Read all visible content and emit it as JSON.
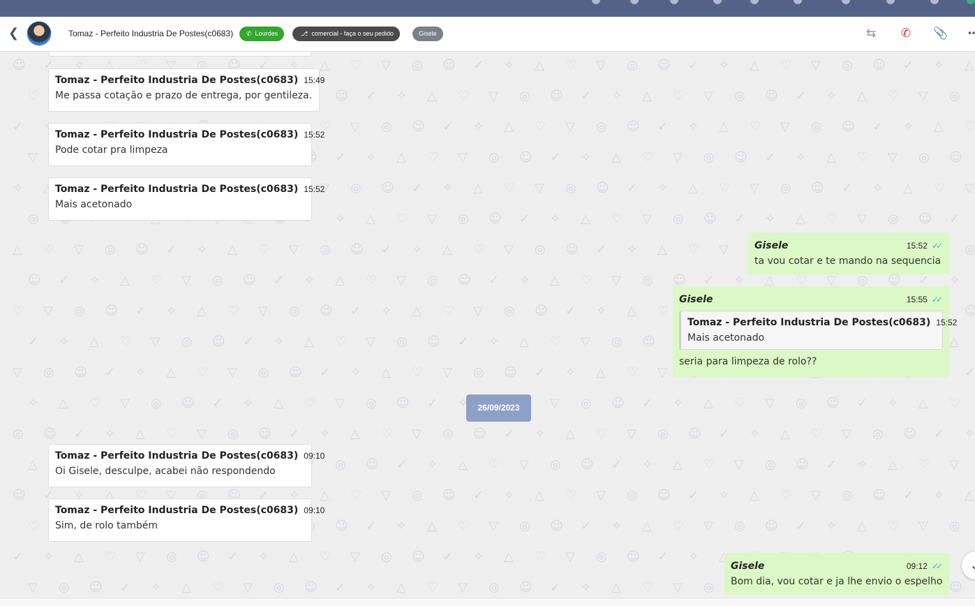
{
  "header": {
    "contact_name": "Tomaz - Perfeito Industria De Postes(c0683)",
    "tags": [
      {
        "label": "Lourdes",
        "icon": "whatsapp-icon",
        "color": "#34a52e"
      },
      {
        "label": "comercial - faça o seu pedido",
        "icon": "sitemap-icon",
        "color": "#4a4a4a"
      },
      {
        "label": "Gisele",
        "color": "#7b7f86"
      }
    ],
    "actions": [
      "transfer-icon",
      "end-call-icon",
      "attach-icon",
      "more-icon"
    ]
  },
  "messages": [
    {
      "direction": "in",
      "sender": "Tomaz - Perfeito Industria De Postes(c0683)",
      "time": "15:49",
      "text": "Me passa cotação e prazo de entrega, por gentileza."
    },
    {
      "direction": "in",
      "sender": "Tomaz - Perfeito Industria De Postes(c0683)",
      "time": "15:52",
      "text": "Pode cotar pra limpeza"
    },
    {
      "direction": "in",
      "sender": "Tomaz - Perfeito Industria De Postes(c0683)",
      "time": "15:52",
      "text": "Mais acetonado"
    },
    {
      "direction": "out",
      "sender": "Gisele",
      "time": "15:52",
      "text": "ta vou cotar e te mando na sequencia",
      "status": "read"
    },
    {
      "direction": "out",
      "sender": "Gisele",
      "time": "15:55",
      "text": "seria para limpeza de rolo??",
      "status": "read",
      "quote": {
        "sender": "Tomaz - Perfeito Industria De Postes(c0683)",
        "time": "15:52",
        "text": "Mais acetonado"
      }
    },
    {
      "direction": "in",
      "sender": "Tomaz - Perfeito Industria De Postes(c0683)",
      "time": "09:10",
      "text": "Oi Gisele, desculpe, acabei não respondendo"
    },
    {
      "direction": "in",
      "sender": "Tomaz - Perfeito Industria De Postes(c0683)",
      "time": "09:10",
      "text": "Sim, de rolo também"
    },
    {
      "direction": "out",
      "sender": "Gisele",
      "time": "09:12",
      "text": "Bom dia, vou cotar e ja lhe envio o espelho",
      "status": "read"
    }
  ],
  "date_separator": "26/09/2023",
  "colors": {
    "topbar": "#546289",
    "incoming": "#ffffff",
    "outgoing": "#dcf8c6",
    "date_chip": "#8fa0c8",
    "read_tick": "#4aa8e0"
  }
}
